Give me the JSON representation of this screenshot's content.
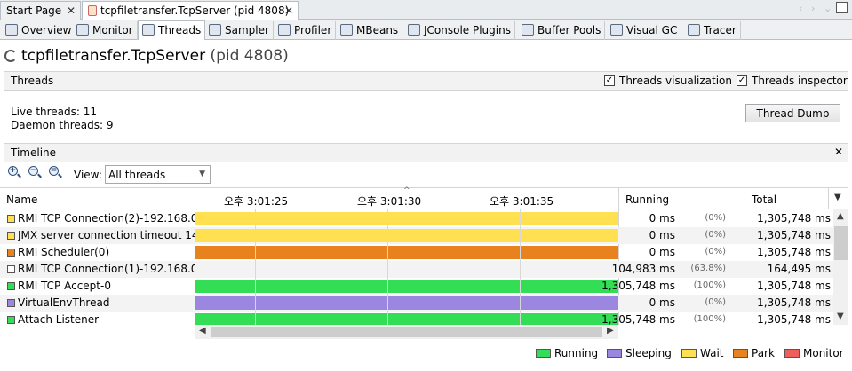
{
  "doc_tabs": [
    {
      "label": "Start Page",
      "active": false
    },
    {
      "label": "tcpfiletransfer.TcpServer (pid 4808)",
      "active": true
    }
  ],
  "sub_tabs": [
    {
      "label": "Overview",
      "icon": "overview-icon"
    },
    {
      "label": "Monitor",
      "icon": "monitor-icon"
    },
    {
      "label": "Threads",
      "icon": "threads-icon"
    },
    {
      "label": "Sampler",
      "icon": "sampler-icon"
    },
    {
      "label": "Profiler",
      "icon": "profiler-icon"
    },
    {
      "label": "MBeans",
      "icon": "mbeans-icon"
    },
    {
      "label": "JConsole Plugins",
      "icon": "jconsole-icon"
    },
    {
      "label": "Buffer Pools",
      "icon": "buffer-pools-icon"
    },
    {
      "label": "Visual GC",
      "icon": "visual-gc-icon"
    },
    {
      "label": "Tracer",
      "icon": "tracer-icon"
    }
  ],
  "title": {
    "name": "tcpfiletransfer.TcpServer",
    "pid": "(pid 4808)"
  },
  "threads_section": {
    "label": "Threads",
    "visualization_label": "Threads visualization",
    "inspector_label": "Threads inspector",
    "visualization_checked": true,
    "inspector_checked": true
  },
  "summary": {
    "live_label": "Live threads:",
    "live_value": "11",
    "daemon_label": "Daemon threads:",
    "daemon_value": "9"
  },
  "thread_dump_label": "Thread Dump",
  "timeline": {
    "label": "Timeline",
    "view_label": "View:",
    "view_value": "All threads",
    "ticks": [
      "오후 3:01:25",
      "오후 3:01:30",
      "오후 3:01:35"
    ]
  },
  "columns": {
    "name": "Name",
    "running": "Running",
    "total": "Total"
  },
  "state_colors": {
    "Running": "#33dd55",
    "Sleeping": "#9b86e0",
    "Wait": "#ffe050",
    "Park": "#e8821e",
    "Monitor": "#ef5d5d"
  },
  "threads": [
    {
      "name": "RMI TCP Connection(2)-192.168.0.",
      "state": "Wait",
      "running": "0 ms",
      "pct": "(0%)",
      "total": "1,305,748 ms"
    },
    {
      "name": "JMX server connection timeout 14",
      "state": "Wait",
      "running": "0 ms",
      "pct": "(0%)",
      "total": "1,305,748 ms"
    },
    {
      "name": "RMI Scheduler(0)",
      "state": "Park",
      "running": "0 ms",
      "pct": "(0%)",
      "total": "1,305,748 ms"
    },
    {
      "name": "RMI TCP Connection(1)-192.168.0.",
      "state": "None",
      "running": "104,983 ms",
      "pct": "(63.8%)",
      "total": "164,495 ms"
    },
    {
      "name": "RMI TCP Accept-0",
      "state": "Running",
      "running": "1,305,748 ms",
      "pct": "(100%)",
      "total": "1,305,748 ms"
    },
    {
      "name": "VirtualEnvThread",
      "state": "Sleeping",
      "running": "0 ms",
      "pct": "(0%)",
      "total": "1,305,748 ms"
    },
    {
      "name": "Attach Listener",
      "state": "Running",
      "running": "1,305,748 ms",
      "pct": "(100%)",
      "total": "1,305,748 ms"
    }
  ],
  "legend": [
    "Running",
    "Sleeping",
    "Wait",
    "Park",
    "Monitor"
  ]
}
